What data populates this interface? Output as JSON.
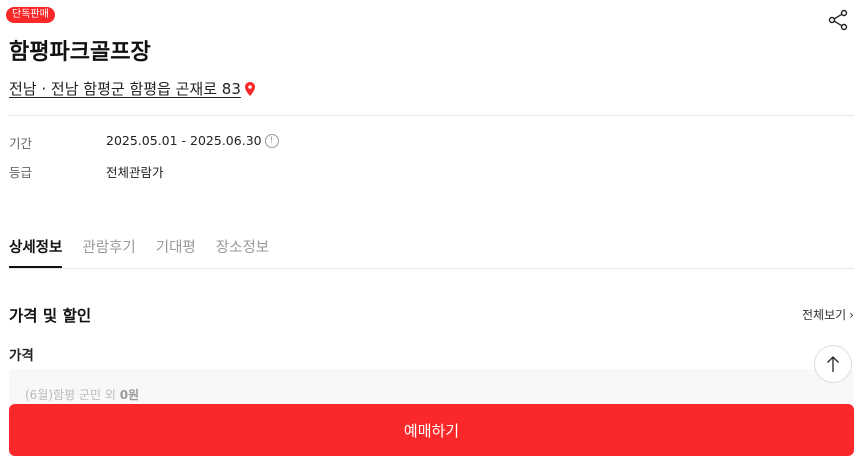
{
  "badge": "단독판매",
  "title": "함평파크골프장",
  "address": "전남 · 전남 함평군 함평읍 곤재로 83",
  "info": {
    "period_label": "기간",
    "period_value": "2025.05.01 - 2025.06.30",
    "period_icon": "!",
    "rating_label": "등급",
    "rating_value": "전체관람가"
  },
  "tabs": [
    "상세정보",
    "관람후기",
    "기대평",
    "장소정보"
  ],
  "pricing": {
    "section_title": "가격 및 할인",
    "see_all": "전체보기",
    "see_all_chevron": "›",
    "sub_title": "가격",
    "line_label": "(6월)함평 군민 외",
    "line_amount": "0원"
  },
  "cta": "예매하기",
  "colors": {
    "brand": "#fa2828",
    "text": "#222222",
    "muted": "#999999"
  },
  "icons": {
    "share": "share-icon",
    "pin": "map-pin-icon",
    "info": "info-circle-icon",
    "scroll_top": "arrow-up-icon",
    "chevron": "chevron-right-icon"
  }
}
